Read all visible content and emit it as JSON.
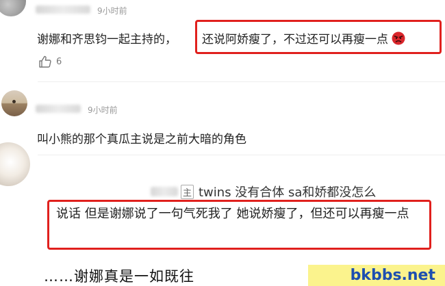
{
  "comment1": {
    "time": "9小时前",
    "text_plain": "谢娜和齐思钧一起主持的，",
    "text_highlight": "还说阿娇瘦了，不过还可以再瘦一点",
    "likes": "6",
    "emoji": "angry-face-icon"
  },
  "comment2": {
    "time": "9小时前",
    "text": "叫小熊的那个真瓜主说是之前大暗的角色"
  },
  "comment3": {
    "partial_label": "主",
    "line1": "twins 没有合体 sa和娇都没怎么",
    "quote": "说话 但是谢娜说了一句气死我了 她说娇瘦了，但还可以再瘦一点"
  },
  "caption": "……谢娜真是一如既往",
  "watermark": "bkbbs.net",
  "colors": {
    "highlight_border": "#e0201d",
    "watermark_bg": "#fbf38d",
    "watermark_text": "#1d4fb0"
  }
}
